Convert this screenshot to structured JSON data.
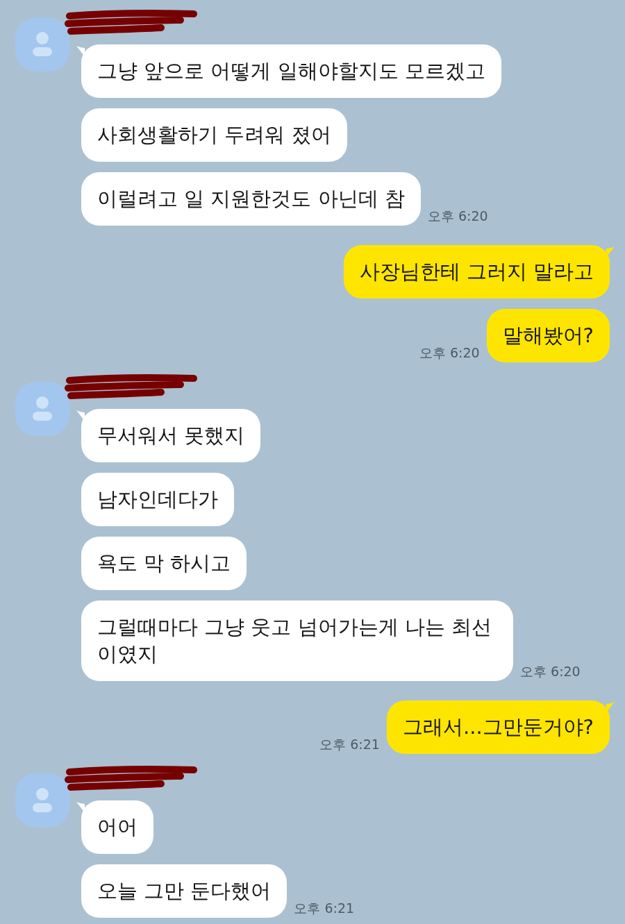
{
  "chat": [
    {
      "kind": "received",
      "messages": [
        {
          "text": "그냥 앞으로 어떻게 일해야할지도 모르겠고"
        },
        {
          "text": "사회생활하기 두려워 졌어"
        },
        {
          "text": "이럴려고 일 지원한것도 아닌데 참"
        }
      ],
      "time": "오후 6:20"
    },
    {
      "kind": "sent",
      "messages": [
        {
          "text": "사장님한테 그러지 말라고"
        },
        {
          "text": "말해봤어?"
        }
      ],
      "time": "오후 6:20"
    },
    {
      "kind": "received",
      "messages": [
        {
          "text": "무서워서 못했지"
        },
        {
          "text": "남자인데다가"
        },
        {
          "text": "욕도 막 하시고"
        },
        {
          "text": "그럴때마다 그냥 웃고 넘어가는게 나는 최선 이였지"
        }
      ],
      "time": "오후 6:20"
    },
    {
      "kind": "sent",
      "messages": [
        {
          "text": "그래서...그만둔거야?"
        }
      ],
      "time": "오후 6:21"
    },
    {
      "kind": "received",
      "messages": [
        {
          "text": "어어"
        },
        {
          "text": "오늘 그만 둔다했어"
        }
      ],
      "time": "오후 6:21"
    }
  ]
}
